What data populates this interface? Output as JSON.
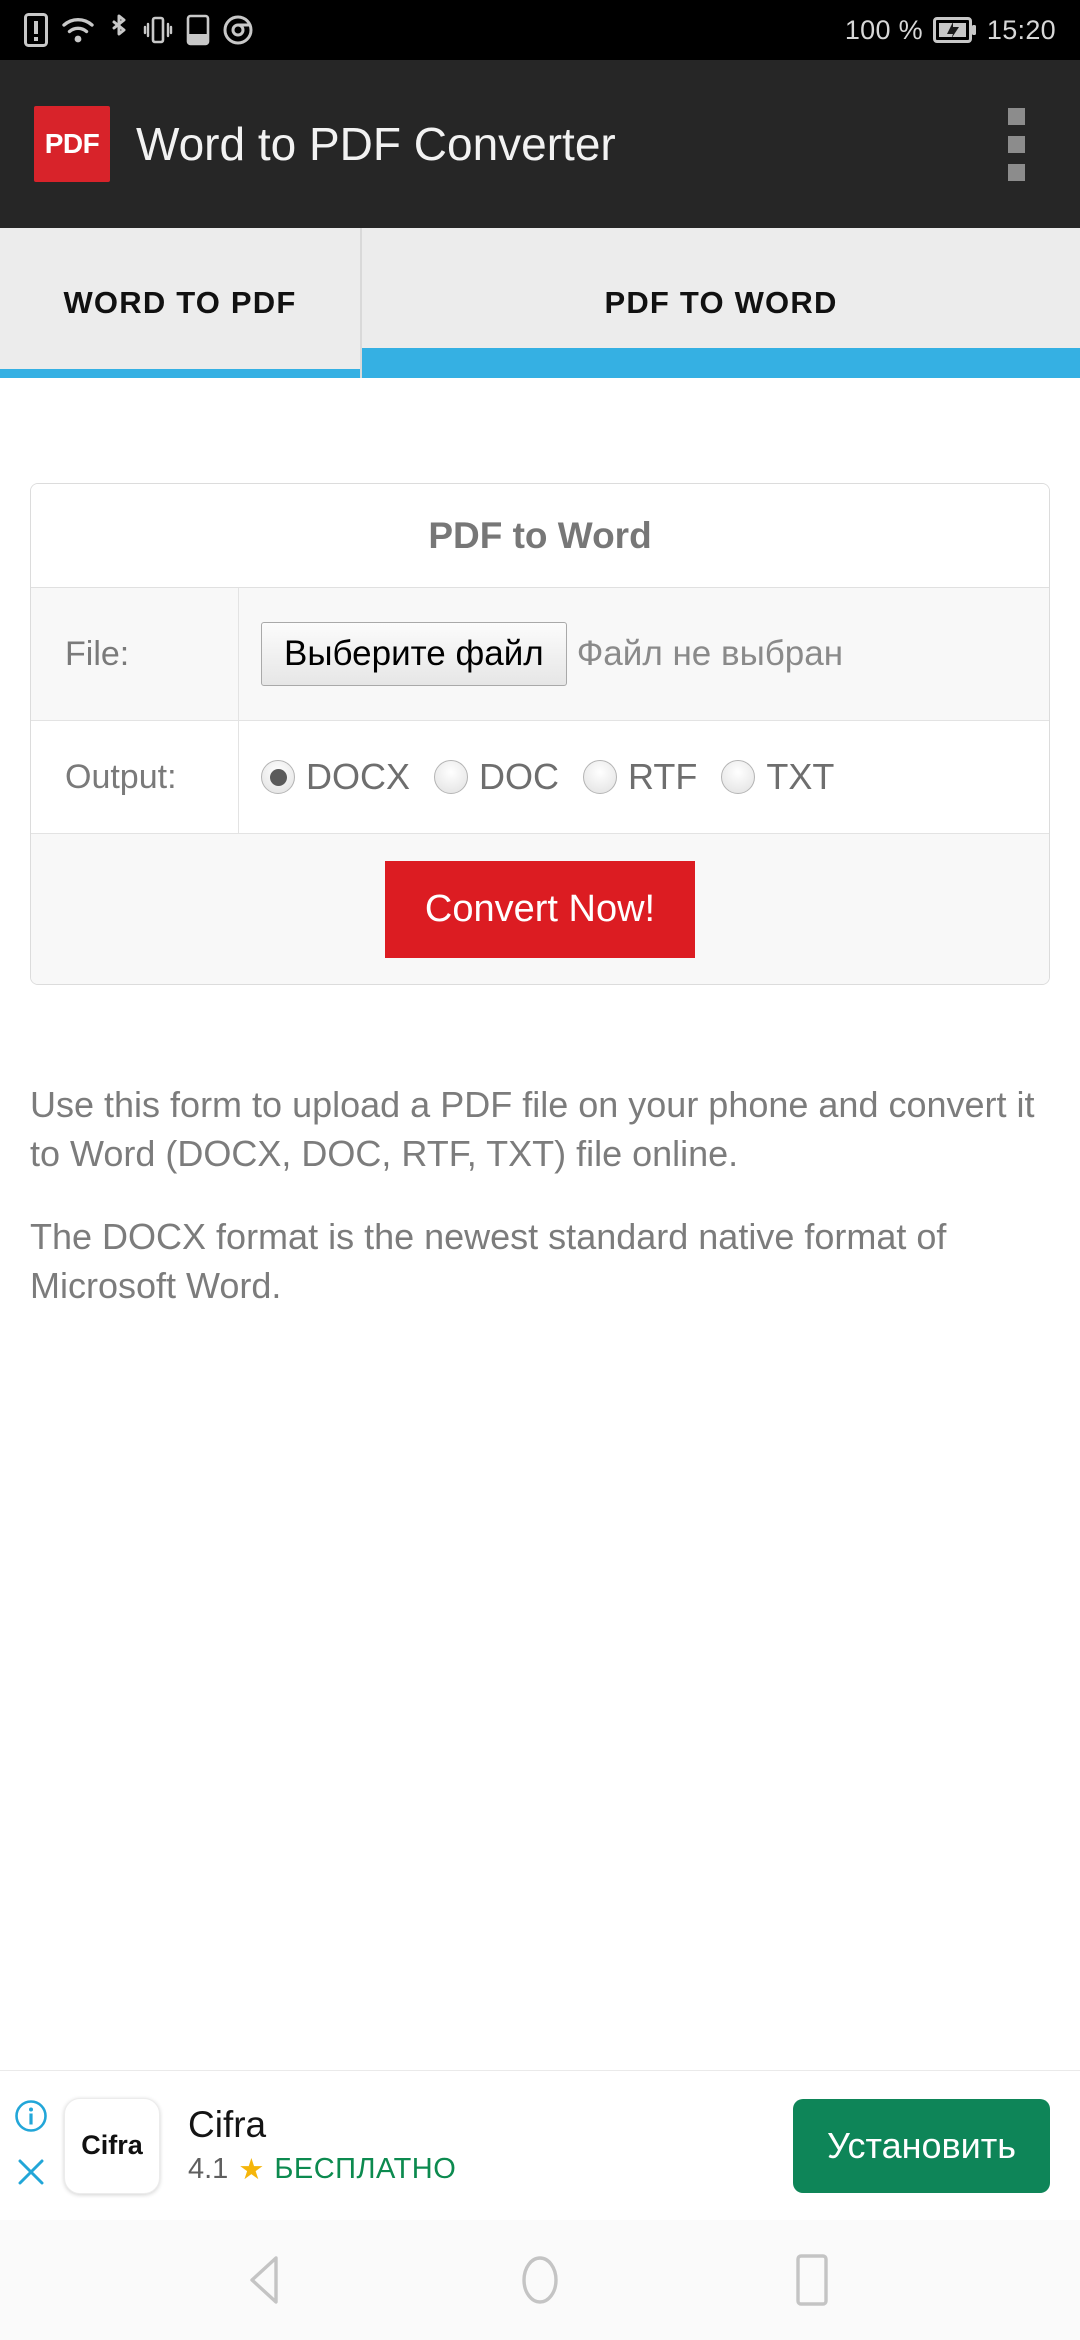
{
  "status_bar": {
    "left_icons": [
      "sim-warning-icon",
      "wifi-icon",
      "bluetooth-icon",
      "vibrate-icon",
      "device-icon",
      "chrome-icon"
    ],
    "battery_percent": "100 %",
    "battery_icon": "battery-icon",
    "time": "15:20"
  },
  "app_bar": {
    "logo_text": "PDF",
    "title": "Word to PDF Converter",
    "overflow_icon": "overflow-menu-icon",
    "background": "#262626",
    "logo_color": "#d8232a"
  },
  "tabs": {
    "accent": "#35b0e3",
    "items": [
      {
        "label": "WORD TO PDF",
        "active": false
      },
      {
        "label": "PDF TO WORD",
        "active": true
      }
    ]
  },
  "form": {
    "heading": "PDF to Word",
    "file_row": {
      "label": "File:",
      "button_label": "Выберите файл",
      "status": "Файл не выбран"
    },
    "output_row": {
      "label": "Output:",
      "options": [
        {
          "label": "DOCX",
          "selected": true
        },
        {
          "label": "DOC",
          "selected": false
        },
        {
          "label": "RTF",
          "selected": false
        },
        {
          "label": "TXT",
          "selected": false
        }
      ]
    },
    "submit": {
      "label": "Convert Now!",
      "color": "#dc1c22"
    }
  },
  "description": {
    "paragraph_1": "Use this form to upload a PDF file on your phone and convert it to Word (DOCX, DOC, RTF, TXT) file online.",
    "paragraph_2": "The DOCX format is the newest standard native format of Microsoft Word."
  },
  "ad": {
    "info_icon": "info-icon",
    "close_icon": "close-icon",
    "app_icon_text": "Cifra",
    "title": "Cifra",
    "rating": "4.1",
    "star_icon": "star-icon",
    "price_label": "БЕСПЛАТНО",
    "install_label": "Установить",
    "install_color": "#0e8558",
    "free_color": "#0c8a4f",
    "accent": "#22a6d8"
  },
  "nav_bar": {
    "back_icon": "back-triangle-icon",
    "home_icon": "home-circle-icon",
    "recents_icon": "recents-square-icon"
  }
}
